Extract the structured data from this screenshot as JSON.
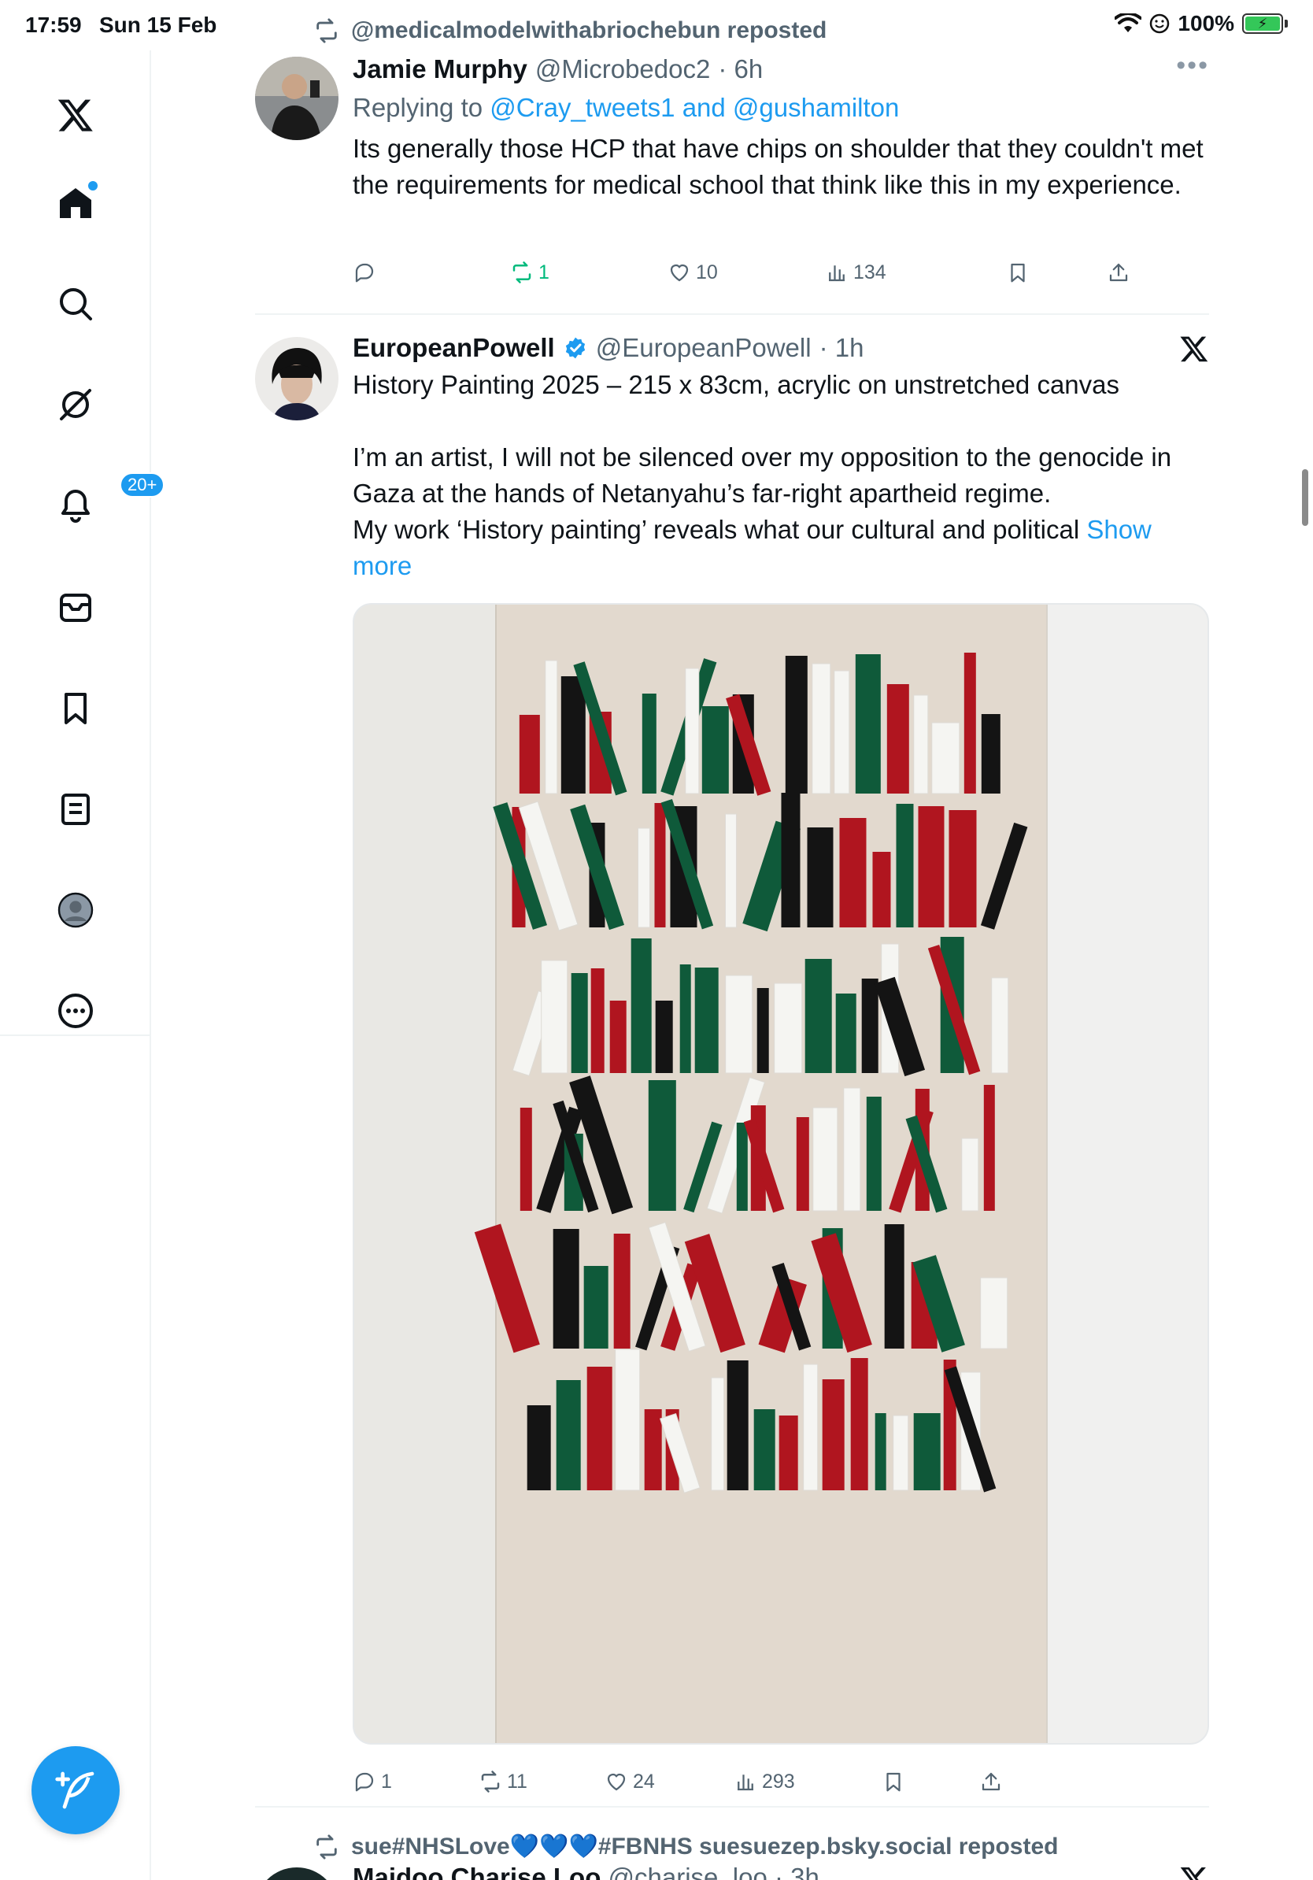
{
  "status_bar": {
    "time": "17:59",
    "date": "Sun 15 Feb",
    "battery": "100%"
  },
  "sidebar": {
    "notifications_badge": "20+",
    "items": [
      {
        "name": "x-logo",
        "icon": "x-logo-icon"
      },
      {
        "name": "home",
        "icon": "home-icon"
      },
      {
        "name": "explore",
        "icon": "search-icon"
      },
      {
        "name": "grok",
        "icon": "grok-icon"
      },
      {
        "name": "notifications",
        "icon": "bell-icon"
      },
      {
        "name": "messages",
        "icon": "mail-icon"
      },
      {
        "name": "bookmarks",
        "icon": "bookmark-icon"
      },
      {
        "name": "lists",
        "icon": "list-icon"
      },
      {
        "name": "profile",
        "icon": "profile-icon"
      },
      {
        "name": "more",
        "icon": "more-icon"
      }
    ],
    "compose_icon": "compose-icon"
  },
  "feed": {
    "tweet1": {
      "reposted_by": "@medicalmodelwithabriochebun reposted",
      "name": "Jamie Murphy",
      "handle": "@Microbedoc2",
      "time": "· 6h",
      "reply_prefix": "Replying to",
      "reply_targets": "@Cray_tweets1 and @gushamilton",
      "text": "Its generally those HCP that have chips on shoulder that they couldn't met the requirements for medical school that think like this in my experience.",
      "replies": "",
      "reposts": "1",
      "likes": "10",
      "views": "134"
    },
    "tweet2": {
      "name": "EuropeanPowell",
      "handle": "@EuropeanPowell",
      "time": "· 1h",
      "text_line1": "History Painting 2025 – 215 x 83cm, acrylic on unstretched canvas",
      "text_para2": "I’m an artist, I will not be silenced over my opposition to the genocide in Gaza at the hands of Netanyahu’s far-right apartheid regime.",
      "text_para3": "My work ‘History painting’ reveals what our cultural and political",
      "show_more": "Show more",
      "replies": "1",
      "reposts": "11",
      "likes": "24",
      "views": "293",
      "image_palette": {
        "red": "#b0151f",
        "green": "#0f5a3a",
        "black": "#141414",
        "white": "#f5f5f2"
      }
    },
    "tweet3": {
      "reposted_by": "sue#NHSLove💙💙💙#FBNHS suesuezep.bsky.social reposted",
      "name_partial": "Maidoo Charise Loo",
      "handle_partial": "@charise_loo · 3h"
    }
  },
  "colors": {
    "accent": "#1d9bf0",
    "repost_green": "#00ba7c",
    "secondary_text": "#536471"
  }
}
